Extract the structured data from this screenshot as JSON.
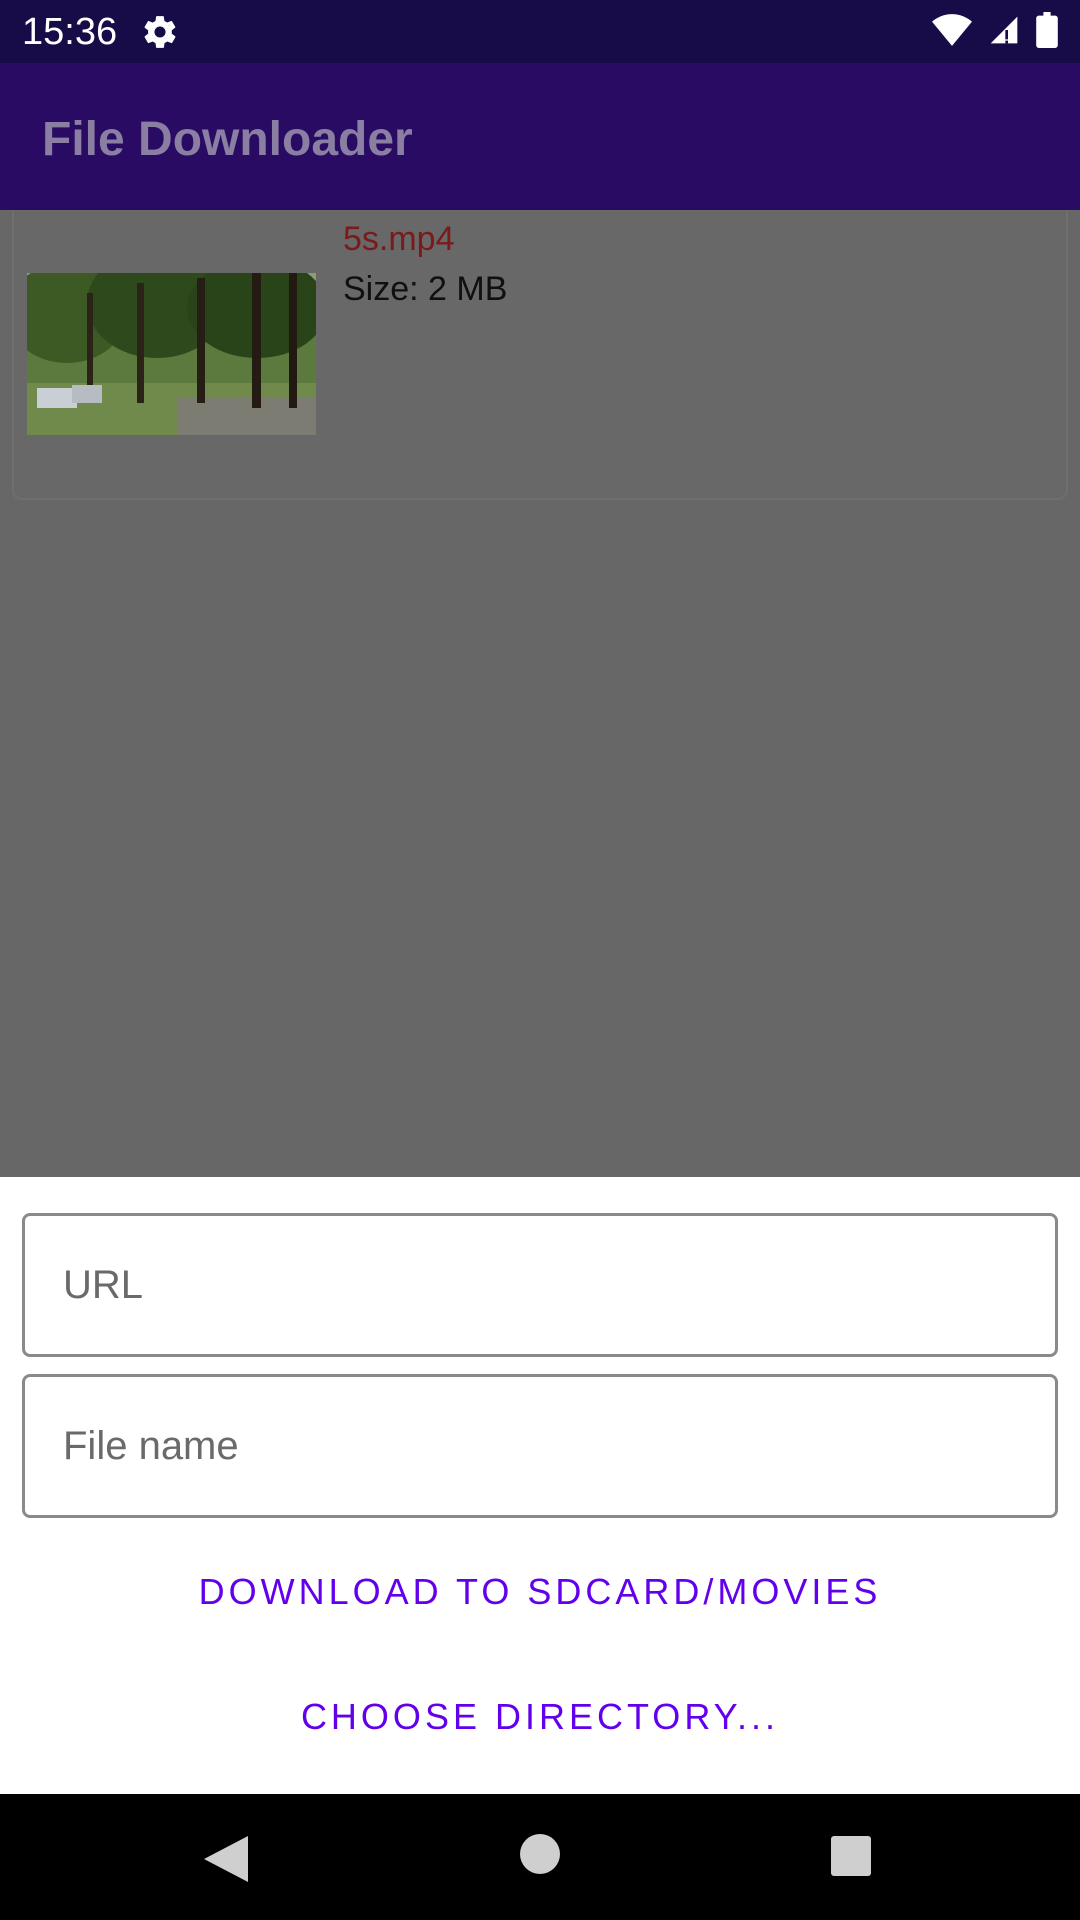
{
  "status_bar": {
    "time": "15:36",
    "icons": [
      "gear-icon",
      "wifi-icon",
      "signal-icon",
      "battery-icon"
    ]
  },
  "app_bar": {
    "title": "File Downloader"
  },
  "downloads": [
    {
      "file_name": "5s.mp4",
      "size": "Size: 2 MB",
      "thumbnail": "video-thumbnail-trees"
    }
  ],
  "dialog": {
    "url_placeholder": "URL",
    "file_name_placeholder": "File name",
    "download_button": "DOWNLOAD TO SDCARD/MOVIES",
    "choose_button": "CHOOSE DIRECTORY..."
  },
  "colors": {
    "status_bar": "#170b48",
    "app_bar": "#2a0b63",
    "accent": "#6200ee",
    "file_name": "#7a1a1a"
  }
}
